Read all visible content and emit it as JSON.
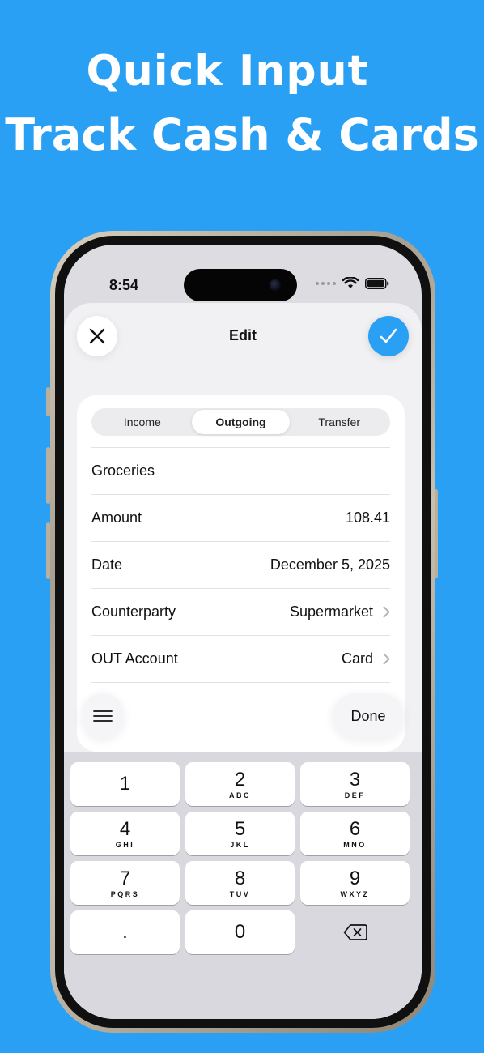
{
  "headline": {
    "line1": "Quick Input",
    "line2": "Track Cash & Cards"
  },
  "status_bar": {
    "time": "8:54"
  },
  "sheet": {
    "title": "Edit",
    "close_icon": "close-icon",
    "confirm_icon": "checkmark-icon"
  },
  "segmented": {
    "items": [
      "Income",
      "Outgoing",
      "Transfer"
    ],
    "selected": "Outgoing"
  },
  "form": {
    "name": "Groceries",
    "rows": [
      {
        "label": "Amount",
        "value": "108.41"
      },
      {
        "label": "Date",
        "value": "December 5, 2025"
      },
      {
        "label": "Counterparty",
        "value": "Supermarket"
      },
      {
        "label": "OUT Account",
        "value": "Card"
      }
    ]
  },
  "toolbar": {
    "menu_icon": "menu-icon",
    "done_label": "Done"
  },
  "keypad": {
    "keys": [
      {
        "num": "1",
        "sub": ""
      },
      {
        "num": "2",
        "sub": "ABC"
      },
      {
        "num": "3",
        "sub": "DEF"
      },
      {
        "num": "4",
        "sub": "GHI"
      },
      {
        "num": "5",
        "sub": "JKL"
      },
      {
        "num": "6",
        "sub": "MNO"
      },
      {
        "num": "7",
        "sub": "PQRS"
      },
      {
        "num": "8",
        "sub": "TUV"
      },
      {
        "num": "9",
        "sub": "WXYZ"
      },
      {
        "num": ".",
        "sub": ""
      },
      {
        "num": "0",
        "sub": ""
      }
    ],
    "delete_icon": "backspace-icon"
  },
  "colors": {
    "background": "#2aa0f5",
    "accent": "#2aa0f5"
  }
}
